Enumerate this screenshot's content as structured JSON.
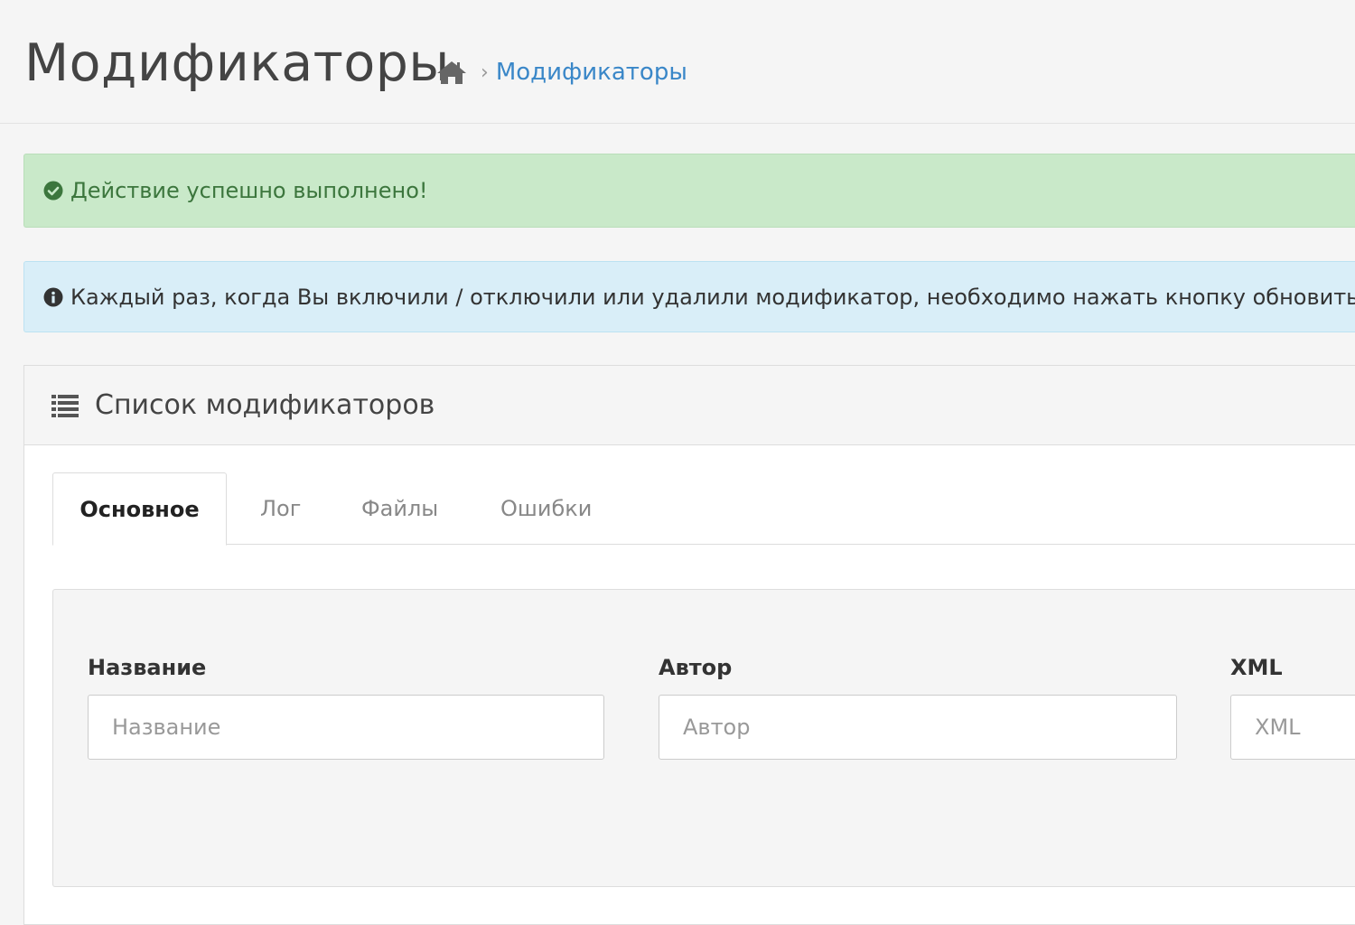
{
  "header": {
    "title": "Модификаторы",
    "breadcrumb": {
      "home_icon": "home-icon",
      "separator": "›",
      "current": "Модификаторы"
    }
  },
  "alerts": {
    "success": {
      "icon": "check-circle-icon",
      "text": "Действие успешно выполнено!"
    },
    "info": {
      "icon": "info-circle-icon",
      "text": "Каждый раз, когда Вы включили / отключили или удалили модификатор, необходимо нажать кнопку обновить, ч"
    }
  },
  "panel": {
    "icon": "list-icon",
    "title": "Список модификаторов",
    "tabs": [
      {
        "label": "Основное",
        "active": true
      },
      {
        "label": "Лог",
        "active": false
      },
      {
        "label": "Файлы",
        "active": false
      },
      {
        "label": "Ошибки",
        "active": false
      }
    ],
    "filter": {
      "name": {
        "label": "Название",
        "placeholder": "Название",
        "value": ""
      },
      "author": {
        "label": "Автор",
        "placeholder": "Автор",
        "value": ""
      },
      "xml": {
        "label": "XML",
        "placeholder": "XML",
        "value": ""
      }
    }
  },
  "colors": {
    "link": "#3a87c8",
    "success_bg": "#c9e9c9",
    "success_text": "#3c763d",
    "info_bg": "#d9eef8"
  }
}
